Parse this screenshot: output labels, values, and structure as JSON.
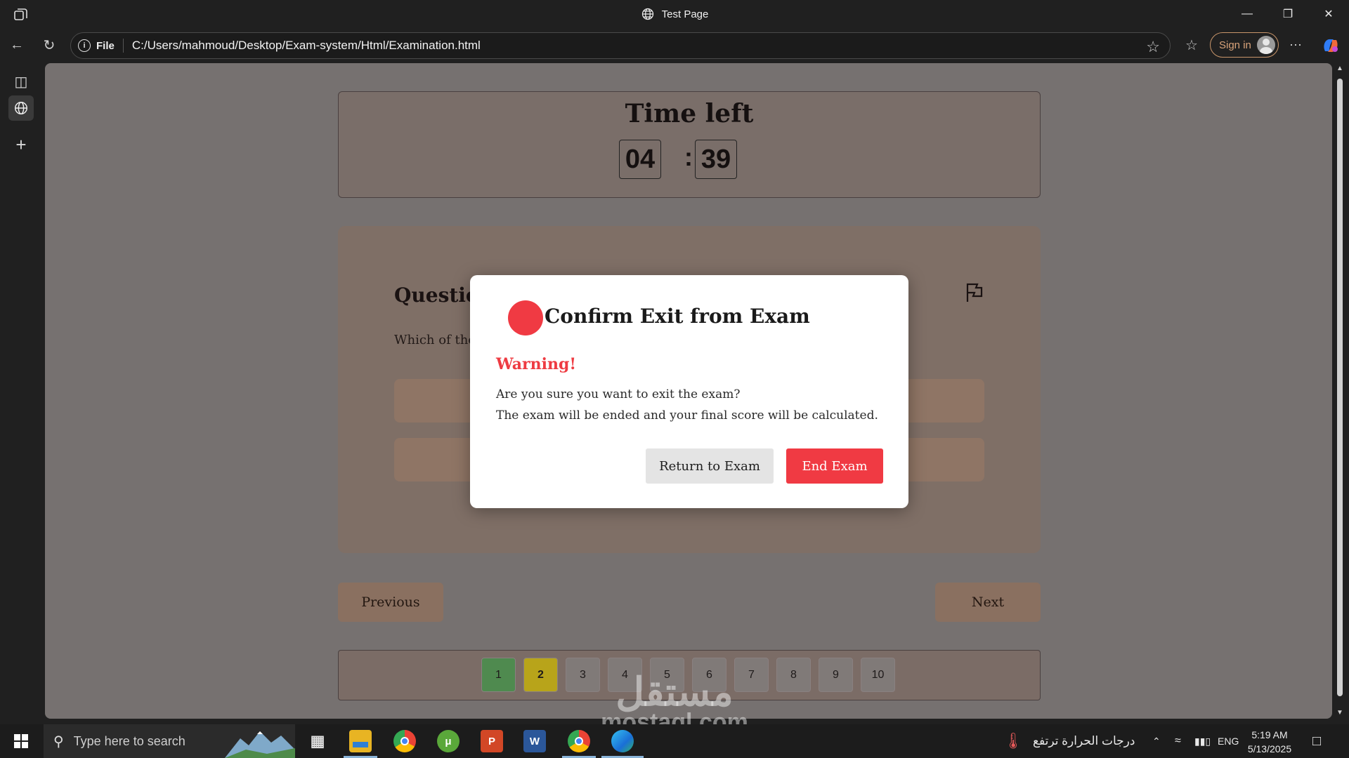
{
  "window": {
    "title": "Test Page"
  },
  "address_bar": {
    "scheme": "File",
    "url": "C:/Users/mahmoud/Desktop/Exam-system/Html/Examination.html"
  },
  "toolbar": {
    "signin_label": "Sign in"
  },
  "timer": {
    "title": "Time left",
    "minutes": "04",
    "separator": ":",
    "seconds": "39"
  },
  "question": {
    "title_visible": "Question",
    "text_visible": "Which of the f"
  },
  "navigation": {
    "previous_label": "Previous",
    "next_label": "Next"
  },
  "pager": {
    "pages": [
      "1",
      "2",
      "3",
      "4",
      "5",
      "6",
      "7",
      "8",
      "9",
      "10"
    ],
    "status_colors": {
      "answered": "#4f8a4f",
      "current": "#b8a41a"
    }
  },
  "dialog": {
    "title": "Confirm Exit from Exam",
    "warning": "Warning!",
    "message_line1": "Are you sure you want to exit the exam?",
    "message_line2": "The exam will be ended and your final score will be calculated.",
    "return_label": "Return to Exam",
    "end_label": "End Exam",
    "accent_color": "#f03a43"
  },
  "taskbar": {
    "search_placeholder": "Type here to search",
    "weather_text": "درجات الحرارة ترتفع",
    "language": "ENG",
    "time": "5:19 AM",
    "date": "5/13/2025"
  },
  "watermark": {
    "line1": "مستقل",
    "line2": "mostaql.com"
  }
}
